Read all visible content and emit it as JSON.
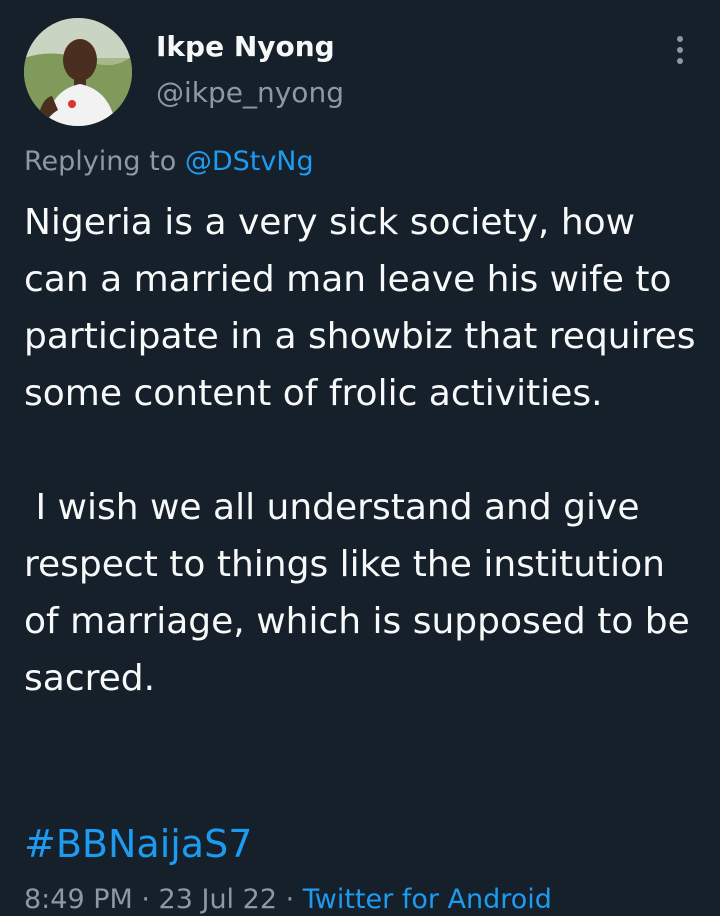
{
  "author": {
    "display_name": "Ikpe Nyong",
    "handle": "@ikpe_nyong",
    "avatar_icon": "profile-photo"
  },
  "more_icon": "more-vertical-icon",
  "reply_context": {
    "prefix": "Replying to ",
    "mention": "@DStvNg"
  },
  "tweet": {
    "paragraph_1": "Nigeria is a very sick society, how can a married man leave his wife to participate in a showbiz that requires some content of frolic activities.",
    "paragraph_2": " I wish we all understand and give respect to things like the institution of marriage, which is supposed to be sacred.",
    "hashtag": "#BBNaijaS7"
  },
  "meta": {
    "time": "8:49 PM",
    "separator_1": " · ",
    "date": "23 Jul 22",
    "separator_2": " · ",
    "source": "Twitter for Android"
  },
  "colors": {
    "background": "#15202b",
    "text": "#f7f9f9",
    "secondary": "#8b98a5",
    "accent": "#1d9bf0"
  }
}
